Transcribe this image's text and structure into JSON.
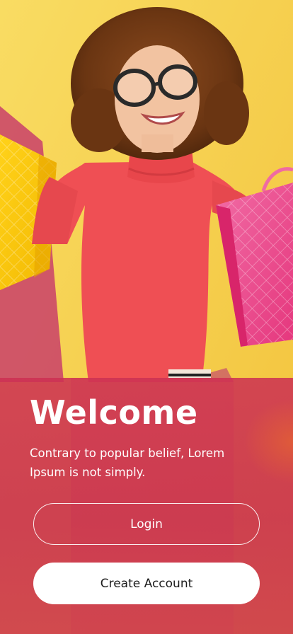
{
  "hero": {
    "image": "woman-with-shopping-bags-photo"
  },
  "welcome": {
    "title": "Welcome",
    "subtitle": "Contrary to popular belief, Lorem Ipsum is not simply."
  },
  "actions": {
    "login_label": "Login",
    "create_account_label": "Create Account"
  },
  "colors": {
    "background": "#f5cd4c",
    "panel": "#cd3052",
    "button_text_dark": "#1d1d1d",
    "white": "#ffffff"
  }
}
